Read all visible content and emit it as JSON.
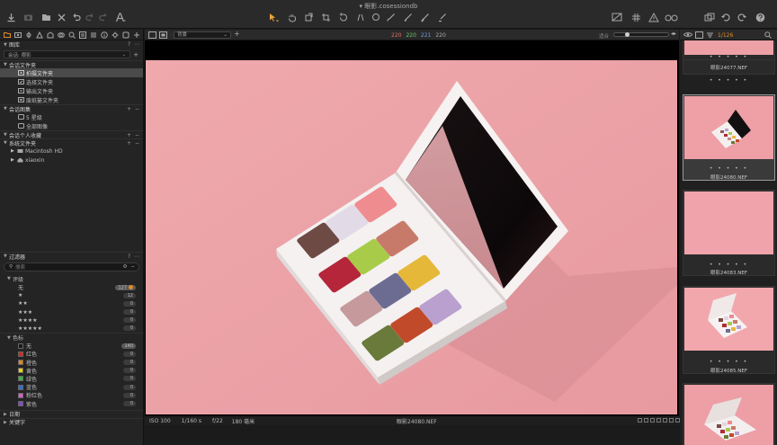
{
  "window": {
    "title": "眼影.cosessiondb"
  },
  "viewer_toolbar": {
    "background_select": "背景",
    "rgb_readout": {
      "r": "220",
      "g": "220",
      "b": "221",
      "a": "220"
    },
    "zoom_label": "适合"
  },
  "library": {
    "title": "图库",
    "session_select": "会话: 眼影",
    "session_folders_title": "会话文件夹",
    "session_folders": [
      "拍摄文件夹",
      "选择文件夹",
      "输出文件夹",
      "废纸篓文件夹"
    ],
    "session_albums_title": "会话图集",
    "session_albums": [
      "5 星级",
      "全部图像"
    ],
    "user_collections_title": "会话个人收藏",
    "system_folders_title": "系统文件夹",
    "system_folders": [
      "Macintosh HD",
      "xiaoxin"
    ]
  },
  "filters": {
    "title": "过滤器",
    "search_placeholder": "搜索",
    "rating_title": "评级",
    "ratings": [
      {
        "label": "无",
        "count": "127"
      },
      {
        "label": "★",
        "count": "12"
      },
      {
        "label": "★★",
        "count": "0"
      },
      {
        "label": "★★★",
        "count": "0"
      },
      {
        "label": "★★★★",
        "count": "0"
      },
      {
        "label": "★★★★★",
        "count": "0"
      }
    ],
    "color_title": "色标",
    "colors": [
      {
        "label": "无",
        "count": "140",
        "color": "#1a1a1a"
      },
      {
        "label": "红色",
        "count": "0",
        "color": "#d9261c"
      },
      {
        "label": "橙色",
        "count": "0",
        "color": "#e8851b"
      },
      {
        "label": "黄色",
        "count": "0",
        "color": "#e8d21b"
      },
      {
        "label": "绿色",
        "count": "0",
        "color": "#36b83a"
      },
      {
        "label": "蓝色",
        "count": "0",
        "color": "#2d6fd8"
      },
      {
        "label": "粉红色",
        "count": "0",
        "color": "#e05ad0"
      },
      {
        "label": "紫色",
        "count": "0",
        "color": "#8a45d8"
      }
    ],
    "date_title": "日期",
    "keyword_title": "关键字"
  },
  "status": {
    "iso": "ISO 100",
    "shutter": "1/160 s",
    "aperture": "f/22",
    "focal": "180 毫米",
    "filename": "眼影24080.NEF"
  },
  "filmstrip": {
    "counter": "1/126",
    "thumbs": [
      {
        "label": "",
        "dots": "• • • • •",
        "selected": false
      },
      {
        "label": "眼影24077.NEF",
        "dots": "",
        "selected": false
      },
      {
        "label": "眼影24080.NEF",
        "dots": "• • • • •",
        "selected": true
      },
      {
        "label": "眼影24083.NEF",
        "dots": "• • • • •",
        "selected": false
      },
      {
        "label": "眼影24085.NEF",
        "dots": "• • • • •",
        "selected": false
      },
      {
        "label": "",
        "dots": "• • • • •",
        "selected": false
      }
    ]
  },
  "colors": {
    "accent": "#e08a2a",
    "panel": "#242424",
    "backdrop": "#eaa4a8"
  }
}
